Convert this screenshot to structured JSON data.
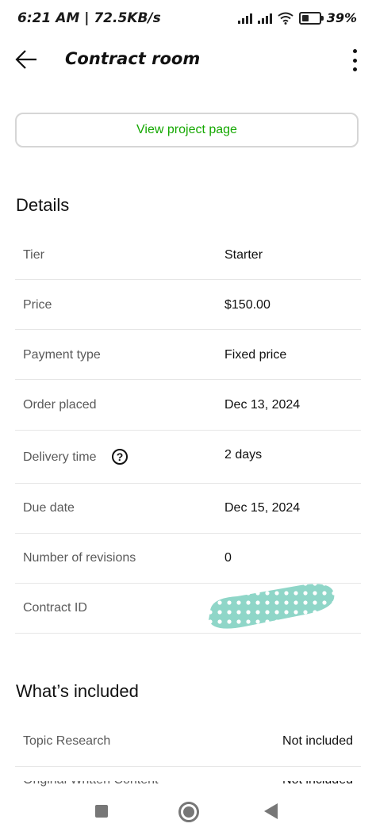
{
  "status_bar": {
    "time_text": "6:21 AM | 72.5KB/s",
    "battery_pct": "39%",
    "battery_level": 0.39
  },
  "header": {
    "title": "Contract room"
  },
  "project": {
    "view_button": "View project page"
  },
  "details": {
    "title": "Details",
    "rows": [
      {
        "label": "Tier",
        "value": "Starter"
      },
      {
        "label": "Price",
        "value": "$150.00"
      },
      {
        "label": "Payment type",
        "value": "Fixed price"
      },
      {
        "label": "Order placed",
        "value": "Dec 13, 2024"
      },
      {
        "label": "Delivery time",
        "value": "2 days"
      },
      {
        "label": "Due date",
        "value": "Dec 15, 2024"
      },
      {
        "label": "Number of revisions",
        "value": "0"
      },
      {
        "label": "Contract ID",
        "value": ""
      }
    ]
  },
  "included": {
    "title": "What’s included",
    "rows": [
      {
        "label": "Topic Research",
        "value": "Not included"
      },
      {
        "label": "Original Written Content",
        "value": "Not included"
      }
    ]
  },
  "colors": {
    "accent": "#14a800",
    "redaction": "#8fd6c8"
  }
}
